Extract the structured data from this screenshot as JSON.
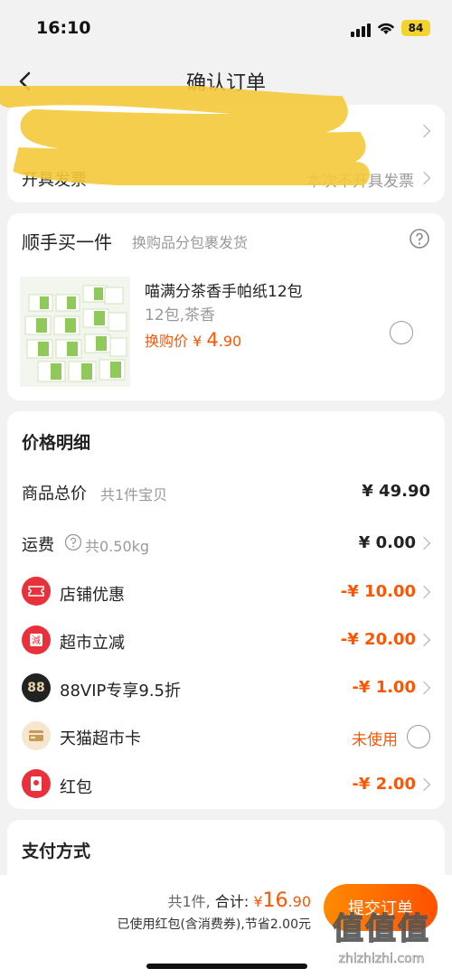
{
  "status": {
    "time": "16:10",
    "battery": "84"
  },
  "nav": {
    "title": "确认订单"
  },
  "invoice": {
    "label": "开具发票",
    "value": "本次不开具发票"
  },
  "addon": {
    "title": "顺手买一件",
    "subtitle": "换购品分包裹发货",
    "product_name": "喵满分茶香手帕纸12包",
    "product_spec": "12包,茶香",
    "price_label": "换购价",
    "price_symbol": "¥",
    "price_int": "4",
    "price_dec": ".90"
  },
  "price_detail": {
    "title": "价格明细",
    "rows": [
      {
        "label": "商品总价",
        "note": "共1件宝贝",
        "value": "¥ 49.90"
      },
      {
        "label": "运费",
        "note": "共0.50kg",
        "value": "¥ 0.00"
      },
      {
        "label": "店铺优惠",
        "value": "-¥ 10.00",
        "icon": "coupon-icon"
      },
      {
        "label": "超市立减",
        "value": "-¥ 20.00",
        "icon": "discount-icon"
      },
      {
        "label": "88VIP专享9.5折",
        "value": "-¥ 1.00",
        "icon": "vip-88-icon"
      },
      {
        "label": "天猫超市卡",
        "value": "未使用",
        "icon": "card-icon"
      },
      {
        "label": "红包",
        "value": "-¥ 2.00",
        "icon": "red-packet-icon"
      }
    ]
  },
  "payment": {
    "title": "支付方式"
  },
  "footer": {
    "count": "共1件,",
    "total_label": "合计:",
    "total_symbol": "¥",
    "total_int": "16",
    "total_dec": ".90",
    "saving": "已使用红包(含消费券),节省2.00元",
    "submit": "提交订单"
  },
  "watermark": {
    "site": "zhizhizhi.com",
    "logo": "值值值"
  },
  "colors": {
    "accent": "#ff5500",
    "background": "#f2f2f2"
  }
}
